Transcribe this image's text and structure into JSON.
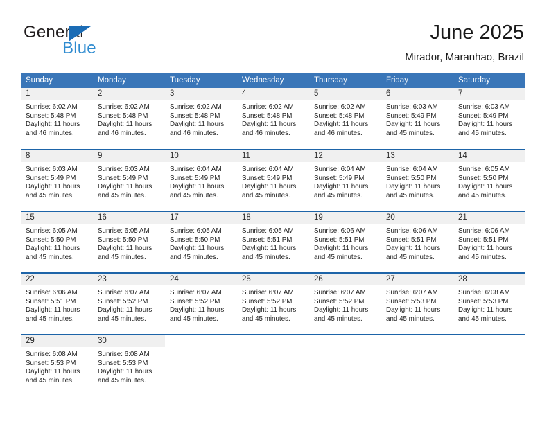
{
  "brand": {
    "word_general": "General",
    "word_blue": "Blue",
    "triangle_color": "#1b6cb5",
    "blue_text_color": "#2e8bd0"
  },
  "header": {
    "title": "June 2025",
    "subtitle": "Mirador, Maranhao, Brazil"
  },
  "theme": {
    "header_row_bg": "#3a76b8",
    "week_separator": "#1d64a8",
    "daynum_band_bg": "#f0f0f0",
    "text": "#222222"
  },
  "calendar": {
    "weekday_headers": [
      "Sunday",
      "Monday",
      "Tuesday",
      "Wednesday",
      "Thursday",
      "Friday",
      "Saturday"
    ],
    "weeks": [
      [
        {
          "day": "1",
          "sunrise": "Sunrise: 6:02 AM",
          "sunset": "Sunset: 5:48 PM",
          "daylight": "Daylight: 11 hours and 46 minutes."
        },
        {
          "day": "2",
          "sunrise": "Sunrise: 6:02 AM",
          "sunset": "Sunset: 5:48 PM",
          "daylight": "Daylight: 11 hours and 46 minutes."
        },
        {
          "day": "3",
          "sunrise": "Sunrise: 6:02 AM",
          "sunset": "Sunset: 5:48 PM",
          "daylight": "Daylight: 11 hours and 46 minutes."
        },
        {
          "day": "4",
          "sunrise": "Sunrise: 6:02 AM",
          "sunset": "Sunset: 5:48 PM",
          "daylight": "Daylight: 11 hours and 46 minutes."
        },
        {
          "day": "5",
          "sunrise": "Sunrise: 6:02 AM",
          "sunset": "Sunset: 5:48 PM",
          "daylight": "Daylight: 11 hours and 46 minutes."
        },
        {
          "day": "6",
          "sunrise": "Sunrise: 6:03 AM",
          "sunset": "Sunset: 5:49 PM",
          "daylight": "Daylight: 11 hours and 45 minutes."
        },
        {
          "day": "7",
          "sunrise": "Sunrise: 6:03 AM",
          "sunset": "Sunset: 5:49 PM",
          "daylight": "Daylight: 11 hours and 45 minutes."
        }
      ],
      [
        {
          "day": "8",
          "sunrise": "Sunrise: 6:03 AM",
          "sunset": "Sunset: 5:49 PM",
          "daylight": "Daylight: 11 hours and 45 minutes."
        },
        {
          "day": "9",
          "sunrise": "Sunrise: 6:03 AM",
          "sunset": "Sunset: 5:49 PM",
          "daylight": "Daylight: 11 hours and 45 minutes."
        },
        {
          "day": "10",
          "sunrise": "Sunrise: 6:04 AM",
          "sunset": "Sunset: 5:49 PM",
          "daylight": "Daylight: 11 hours and 45 minutes."
        },
        {
          "day": "11",
          "sunrise": "Sunrise: 6:04 AM",
          "sunset": "Sunset: 5:49 PM",
          "daylight": "Daylight: 11 hours and 45 minutes."
        },
        {
          "day": "12",
          "sunrise": "Sunrise: 6:04 AM",
          "sunset": "Sunset: 5:49 PM",
          "daylight": "Daylight: 11 hours and 45 minutes."
        },
        {
          "day": "13",
          "sunrise": "Sunrise: 6:04 AM",
          "sunset": "Sunset: 5:50 PM",
          "daylight": "Daylight: 11 hours and 45 minutes."
        },
        {
          "day": "14",
          "sunrise": "Sunrise: 6:05 AM",
          "sunset": "Sunset: 5:50 PM",
          "daylight": "Daylight: 11 hours and 45 minutes."
        }
      ],
      [
        {
          "day": "15",
          "sunrise": "Sunrise: 6:05 AM",
          "sunset": "Sunset: 5:50 PM",
          "daylight": "Daylight: 11 hours and 45 minutes."
        },
        {
          "day": "16",
          "sunrise": "Sunrise: 6:05 AM",
          "sunset": "Sunset: 5:50 PM",
          "daylight": "Daylight: 11 hours and 45 minutes."
        },
        {
          "day": "17",
          "sunrise": "Sunrise: 6:05 AM",
          "sunset": "Sunset: 5:50 PM",
          "daylight": "Daylight: 11 hours and 45 minutes."
        },
        {
          "day": "18",
          "sunrise": "Sunrise: 6:05 AM",
          "sunset": "Sunset: 5:51 PM",
          "daylight": "Daylight: 11 hours and 45 minutes."
        },
        {
          "day": "19",
          "sunrise": "Sunrise: 6:06 AM",
          "sunset": "Sunset: 5:51 PM",
          "daylight": "Daylight: 11 hours and 45 minutes."
        },
        {
          "day": "20",
          "sunrise": "Sunrise: 6:06 AM",
          "sunset": "Sunset: 5:51 PM",
          "daylight": "Daylight: 11 hours and 45 minutes."
        },
        {
          "day": "21",
          "sunrise": "Sunrise: 6:06 AM",
          "sunset": "Sunset: 5:51 PM",
          "daylight": "Daylight: 11 hours and 45 minutes."
        }
      ],
      [
        {
          "day": "22",
          "sunrise": "Sunrise: 6:06 AM",
          "sunset": "Sunset: 5:51 PM",
          "daylight": "Daylight: 11 hours and 45 minutes."
        },
        {
          "day": "23",
          "sunrise": "Sunrise: 6:07 AM",
          "sunset": "Sunset: 5:52 PM",
          "daylight": "Daylight: 11 hours and 45 minutes."
        },
        {
          "day": "24",
          "sunrise": "Sunrise: 6:07 AM",
          "sunset": "Sunset: 5:52 PM",
          "daylight": "Daylight: 11 hours and 45 minutes."
        },
        {
          "day": "25",
          "sunrise": "Sunrise: 6:07 AM",
          "sunset": "Sunset: 5:52 PM",
          "daylight": "Daylight: 11 hours and 45 minutes."
        },
        {
          "day": "26",
          "sunrise": "Sunrise: 6:07 AM",
          "sunset": "Sunset: 5:52 PM",
          "daylight": "Daylight: 11 hours and 45 minutes."
        },
        {
          "day": "27",
          "sunrise": "Sunrise: 6:07 AM",
          "sunset": "Sunset: 5:53 PM",
          "daylight": "Daylight: 11 hours and 45 minutes."
        },
        {
          "day": "28",
          "sunrise": "Sunrise: 6:08 AM",
          "sunset": "Sunset: 5:53 PM",
          "daylight": "Daylight: 11 hours and 45 minutes."
        }
      ],
      [
        {
          "day": "29",
          "sunrise": "Sunrise: 6:08 AM",
          "sunset": "Sunset: 5:53 PM",
          "daylight": "Daylight: 11 hours and 45 minutes."
        },
        {
          "day": "30",
          "sunrise": "Sunrise: 6:08 AM",
          "sunset": "Sunset: 5:53 PM",
          "daylight": "Daylight: 11 hours and 45 minutes."
        },
        {
          "day": "",
          "sunrise": "",
          "sunset": "",
          "daylight": ""
        },
        {
          "day": "",
          "sunrise": "",
          "sunset": "",
          "daylight": ""
        },
        {
          "day": "",
          "sunrise": "",
          "sunset": "",
          "daylight": ""
        },
        {
          "day": "",
          "sunrise": "",
          "sunset": "",
          "daylight": ""
        },
        {
          "day": "",
          "sunrise": "",
          "sunset": "",
          "daylight": ""
        }
      ]
    ]
  }
}
